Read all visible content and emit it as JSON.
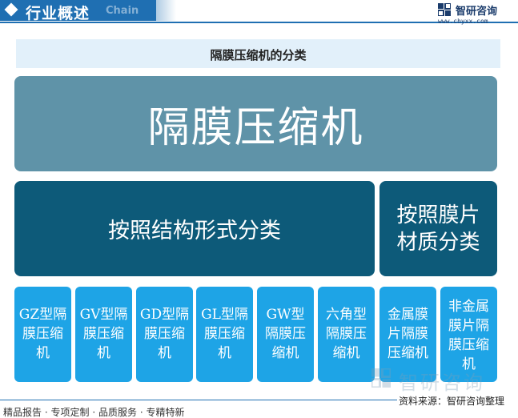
{
  "header": {
    "title": "行业概述",
    "subtitle": "Chain",
    "brand_color": "#1f6fb2"
  },
  "logo": {
    "name": "智研咨询",
    "url": "www.chyxx.com",
    "icon": "chyxx-logo-icon"
  },
  "diagram": {
    "title": "隔膜压缩机的分类",
    "root": "隔膜压缩机",
    "categories": [
      "按照结构形式分类",
      "按照膜片材质分类"
    ],
    "leaves": [
      "GZ型隔膜压缩机",
      "GV型隔膜压缩机",
      "GD型隔膜压缩机",
      "GL型隔膜压缩机",
      "GW型隔膜压缩机",
      "六角型隔膜压缩机",
      "金属膜片隔膜压缩机",
      "非金属膜片隔膜压缩机"
    ],
    "colors": {
      "root": "#5f93a8",
      "category": "#0d5a79",
      "leaf": "#1ea4e6",
      "title_band": "#e2f0fa"
    }
  },
  "watermark": {
    "text": "智研咨询"
  },
  "source": "资料来源：智研咨询整理",
  "footer": {
    "items": [
      "精品报告",
      "专项定制",
      "品质服务",
      "专精特新"
    ]
  }
}
